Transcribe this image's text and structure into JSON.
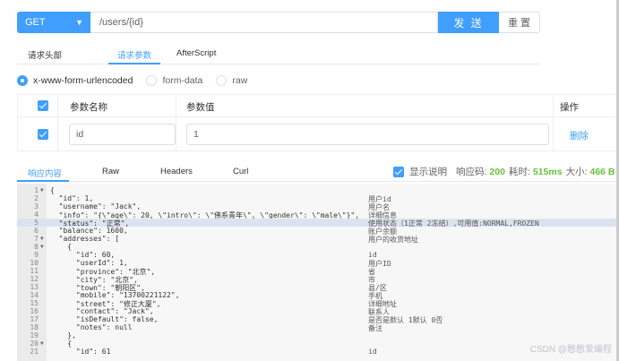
{
  "request": {
    "method": "GET",
    "url": "/users/{id}",
    "send_label": "发 送",
    "reset_label": "重 置"
  },
  "request_tabs": [
    "请求头部",
    "请求参数",
    "AfterScript"
  ],
  "body_types": [
    "x-www-form-urlencoded",
    "form-data",
    "raw"
  ],
  "params_table": {
    "headers": [
      "参数名称",
      "参数值",
      "操作"
    ],
    "rows": [
      {
        "name": "id",
        "value": "1",
        "action": "删除"
      }
    ]
  },
  "response_tabs": [
    "响应内容",
    "Raw",
    "Headers",
    "Curl"
  ],
  "response_meta": {
    "show_desc_label": "显示说明",
    "status_label": "响应码:",
    "status_value": "200",
    "time_label": "耗时:",
    "time_value": "515ms",
    "size_label": "大小:",
    "size_value": "466 B"
  },
  "code_lines": [
    {
      "n": "1",
      "fold": true,
      "text": "{",
      "comment": ""
    },
    {
      "n": "2",
      "fold": false,
      "text": "  \"id\": 1,",
      "comment": "用户id"
    },
    {
      "n": "3",
      "fold": false,
      "text": "  \"username\": \"Jack\",",
      "comment": "用户名"
    },
    {
      "n": "4",
      "fold": false,
      "text": "  \"info\": \"{\\\"age\\\": 20, \\\"intro\\\": \\\"佛系青年\\\", \\\"gender\\\": \\\"male\\\"}\",",
      "comment": "详细信息"
    },
    {
      "n": "5",
      "fold": false,
      "text": "  \"status\": \"正常\",",
      "comment": "使用状态（1正常 2冻结）,可用值:NORMAL,FROZEN"
    },
    {
      "n": "6",
      "fold": false,
      "text": "  \"balance\": 1600,",
      "comment": "账户余额"
    },
    {
      "n": "7",
      "fold": true,
      "text": "  \"addresses\": [",
      "comment": "用户的收货地址"
    },
    {
      "n": "8",
      "fold": true,
      "text": "    {",
      "comment": ""
    },
    {
      "n": "9",
      "fold": false,
      "text": "      \"id\": 60,",
      "comment": "id"
    },
    {
      "n": "10",
      "fold": false,
      "text": "      \"userId\": 1,",
      "comment": "用户ID"
    },
    {
      "n": "11",
      "fold": false,
      "text": "      \"province\": \"北京\",",
      "comment": "省"
    },
    {
      "n": "12",
      "fold": false,
      "text": "      \"city\": \"北京\",",
      "comment": "市"
    },
    {
      "n": "13",
      "fold": false,
      "text": "      \"town\": \"朝阳区\",",
      "comment": "县/区"
    },
    {
      "n": "14",
      "fold": false,
      "text": "      \"mobile\": \"13700221122\",",
      "comment": "手机"
    },
    {
      "n": "15",
      "fold": false,
      "text": "      \"street\": \"修正大厦\",",
      "comment": "详细地址"
    },
    {
      "n": "16",
      "fold": false,
      "text": "      \"contact\": \"Jack\",",
      "comment": "联系人"
    },
    {
      "n": "17",
      "fold": false,
      "text": "      \"isDefault\": false,",
      "comment": "是否是默认 1默认 0否"
    },
    {
      "n": "18",
      "fold": false,
      "text": "      \"notes\": null",
      "comment": "备注"
    },
    {
      "n": "19",
      "fold": false,
      "text": "    },",
      "comment": ""
    },
    {
      "n": "20",
      "fold": true,
      "text": "    {",
      "comment": ""
    },
    {
      "n": "21",
      "fold": false,
      "text": "      \"id\": 61",
      "comment": "id"
    }
  ],
  "highlighted_line": "5",
  "watermark": "CSDN @憨憨爱编程",
  "colors": {
    "accent": "#409eff",
    "success": "#67c23a"
  }
}
